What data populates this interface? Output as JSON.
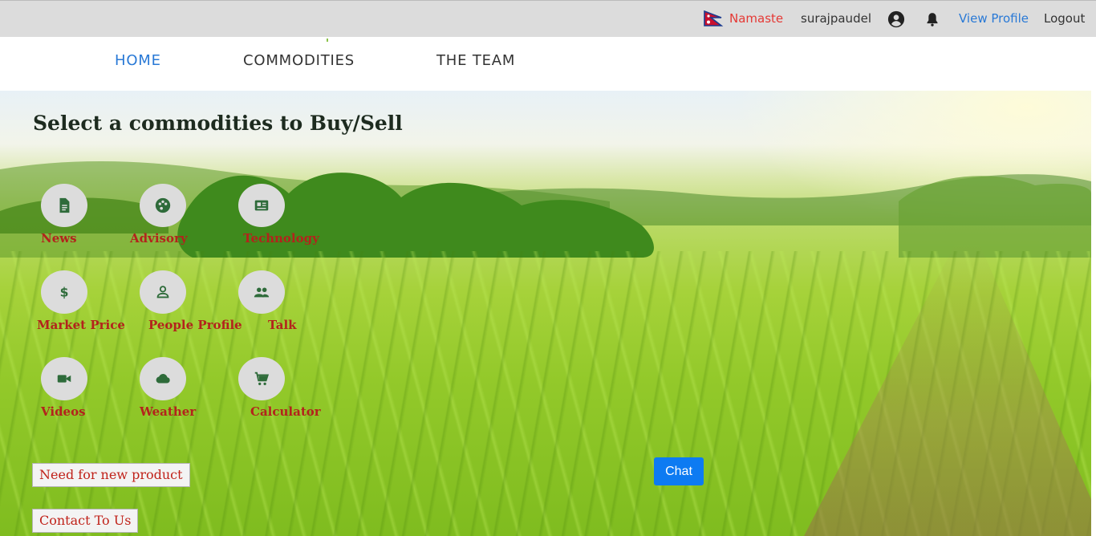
{
  "topbar": {
    "greeting": "Namaste",
    "username": "surajpaudel",
    "icons": [
      "nepal-flag-icon",
      "user-circle-icon",
      "bell-icon"
    ],
    "view_profile": "View Profile",
    "logout": "Logout"
  },
  "nav": {
    "items": [
      {
        "label": "HOME",
        "active": true
      },
      {
        "label": "COMMODITIES",
        "active": false
      },
      {
        "label": "THE TEAM",
        "active": false
      }
    ]
  },
  "hero": {
    "title": "Select a commodities to Buy/Sell",
    "tiles": [
      {
        "label": "News",
        "icon": "document-icon"
      },
      {
        "label": "Advisory",
        "icon": "palette-icon"
      },
      {
        "label": "Technology",
        "icon": "newspaper-icon"
      },
      {
        "label": "Market Price",
        "icon": "dollar-icon"
      },
      {
        "label": "People Profile",
        "icon": "person-icon"
      },
      {
        "label": "Talk",
        "icon": "people-icon"
      },
      {
        "label": "Videos",
        "icon": "video-camera-icon"
      },
      {
        "label": "Weather",
        "icon": "cloud-icon"
      },
      {
        "label": "Calculator",
        "icon": "cart-icon"
      }
    ],
    "need_product": "Need for new product",
    "contact": "Contact To Us",
    "chat": "Chat"
  },
  "colors": {
    "accent_blue": "#2979d6",
    "label_red": "#b3231c",
    "icon_green": "#2e6b3a",
    "chat_blue": "#0d7bf2"
  }
}
